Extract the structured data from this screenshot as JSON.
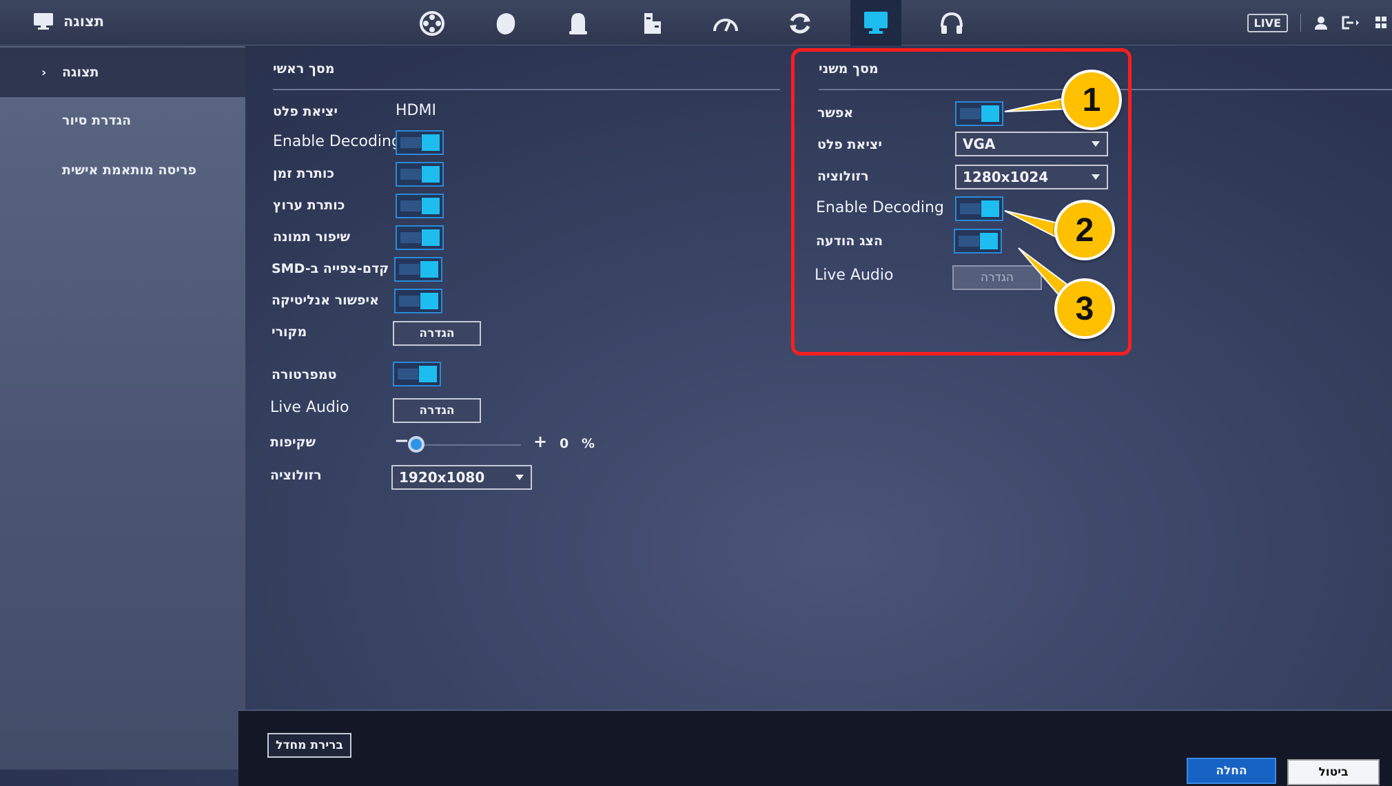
{
  "topbar": {
    "title": "תצוגה",
    "live_label": "LIVE",
    "icons": [
      "camera-reel-icon",
      "face-icon",
      "ai-icon",
      "storage-icon",
      "speedometer-icon",
      "sync-icon",
      "display-icon",
      "headset-icon"
    ],
    "active_icon": "display-icon",
    "accent_color": "#1ebdf0"
  },
  "sidebar": {
    "items": [
      {
        "label": "תצוגה",
        "active": true
      },
      {
        "label": "הגדרת סיור"
      },
      {
        "label": "פריסה מותאמת אישית"
      }
    ]
  },
  "main_screen": {
    "heading": "מסך ראשי",
    "output_label": "יציאת פלט",
    "output_value": "HDMI",
    "enable_decoding_label": "Enable Decoding",
    "time_title_label": "כותרת זמן",
    "channel_title_label": "כותרת ערוץ",
    "image_enhance_label": "שיפור תמונה",
    "smd_preview_label": "SMD-קדם-צפייה ב",
    "analytics_label": "איפשור אנליטיקה",
    "source_label": "מקורי",
    "source_button": "הגדרה",
    "temperature_label": "טמפרטורה",
    "live_audio_label": "Live Audio",
    "live_audio_button": "הגדרה",
    "transparency_label": "שקיפות",
    "transparency_value": "0",
    "transparency_unit": "%",
    "resolution_label": "רזולוציה",
    "resolution_value": "1920x1080"
  },
  "secondary_screen": {
    "heading": "מסך משני",
    "enable_label": "אפשר",
    "output_label": "יציאת פלט",
    "output_value": "VGA",
    "resolution_label": "רזולוציה",
    "resolution_value": "1280x1024",
    "enable_decoding_label": "Enable Decoding",
    "show_message_label": "הצג הודעה",
    "live_audio_label": "Live Audio",
    "live_audio_button": "הגדרה"
  },
  "annotations": {
    "callouts": [
      "1",
      "2",
      "3"
    ],
    "highlight_color": "#ff1e1e",
    "callout_color": "#ffc000"
  },
  "footer": {
    "default_button": "ברירת מחדל",
    "apply_button": "החלה",
    "cancel_button": "ביטול"
  }
}
